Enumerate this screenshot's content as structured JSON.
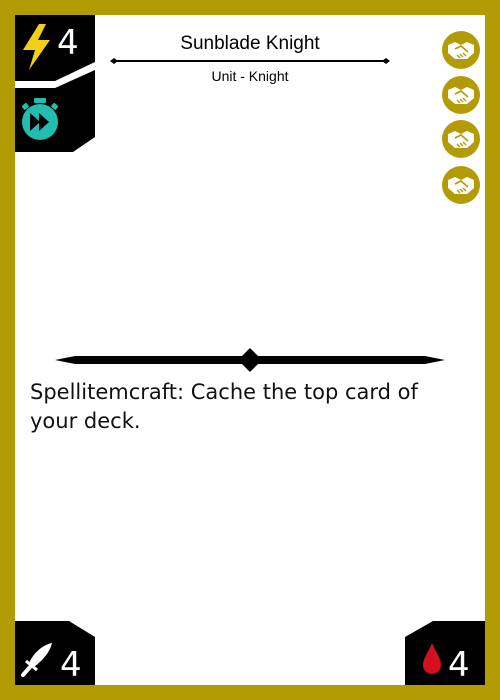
{
  "card": {
    "name": "Sunblade Knight",
    "type_line": "Unit - Knight",
    "energy_cost": "4",
    "power": "4",
    "health": "4",
    "ability_text": "Spellitemcraft: Cache the top card of your deck.",
    "frame_color": "#b39b06",
    "accent_color": "#22bcb0",
    "icons": {
      "cost": "lightning-bolt-icon",
      "speed": "fast-forward-stopwatch-icon",
      "traits": [
        "handshake-icon",
        "handshake-icon",
        "handshake-icon",
        "handshake-icon"
      ],
      "power": "sword-icon",
      "health": "blood-drop-icon"
    }
  }
}
